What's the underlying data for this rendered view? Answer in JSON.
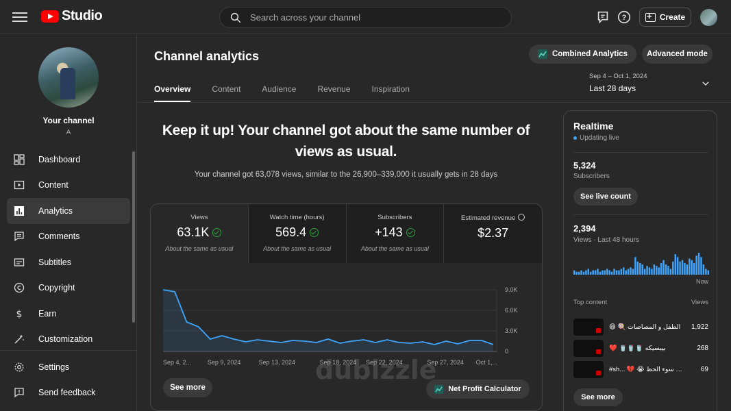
{
  "topbar": {
    "app_name": "Studio",
    "search_placeholder": "Search across your channel",
    "create_label": "Create"
  },
  "sidebar": {
    "channel_name": "Your channel",
    "channel_handle": "A",
    "items": [
      {
        "label": "Dashboard",
        "icon": "dashboard-icon"
      },
      {
        "label": "Content",
        "icon": "content-icon"
      },
      {
        "label": "Analytics",
        "icon": "analytics-icon",
        "active": true
      },
      {
        "label": "Comments",
        "icon": "comments-icon"
      },
      {
        "label": "Subtitles",
        "icon": "subtitles-icon"
      },
      {
        "label": "Copyright",
        "icon": "copyright-icon"
      },
      {
        "label": "Earn",
        "icon": "earn-icon"
      },
      {
        "label": "Customization",
        "icon": "customization-icon"
      }
    ],
    "bottom_items": [
      {
        "label": "Settings",
        "icon": "gear-icon"
      },
      {
        "label": "Send feedback",
        "icon": "feedback-icon"
      }
    ]
  },
  "main": {
    "title": "Channel analytics",
    "combined_label": "Combined Analytics",
    "advanced_label": "Advanced mode",
    "tabs": [
      {
        "label": "Overview",
        "active": true
      },
      {
        "label": "Content"
      },
      {
        "label": "Audience"
      },
      {
        "label": "Revenue"
      },
      {
        "label": "Inspiration"
      }
    ],
    "date_range": {
      "dates": "Sep 4 – Oct 1, 2024",
      "period": "Last 28 days"
    },
    "headline": "Keep it up! Your channel got about the same number of views as usual.",
    "subline": "Your channel got 63,078 views, similar to the 26,900–339,000 it usually gets in 28 days",
    "metrics": [
      {
        "name": "Views",
        "value": "63.1K",
        "note": "About the same as usual",
        "check": true
      },
      {
        "name": "Watch time (hours)",
        "value": "569.4",
        "note": "About the same as usual",
        "check": true
      },
      {
        "name": "Subscribers",
        "value": "+143",
        "note": "About the same as usual",
        "check": true
      },
      {
        "name": "Estimated revenue",
        "value": "$2.37",
        "note": "",
        "check": false
      }
    ],
    "see_more_label": "See more",
    "npc_label": "Net Profit Calculator",
    "watermark_text": "dubizzle"
  },
  "chart_data": {
    "type": "area",
    "x": [
      "Sep 4, 2...",
      "Sep 9, 2024",
      "Sep 13, 2024",
      "Sep 18, 2024",
      "Sep 22, 2024",
      "Sep 27, 2024",
      "Oct 1,..."
    ],
    "y_ticks": [
      "9.0K",
      "6.0K",
      "3.0K",
      "0"
    ],
    "ylim": [
      0,
      9000
    ],
    "series": [
      {
        "values": [
          9000,
          8700,
          4300,
          3600,
          1800,
          2300,
          1800,
          1400,
          1700,
          1500,
          1300,
          1600,
          1500,
          1300,
          1800,
          1200,
          1500,
          1700,
          1300,
          1700,
          1300,
          1200,
          1400,
          1000,
          1500,
          1100,
          1600,
          1600,
          1000
        ]
      }
    ],
    "color": "#3ea6ff"
  },
  "realtime": {
    "title": "Realtime",
    "live_label": "Updating live",
    "subscribers_value": "5,324",
    "subscribers_label": "Subscribers",
    "live_count_label": "See live count",
    "views_value": "2,394",
    "views_label": "Views · Last 48 hours",
    "now_label": "Now",
    "top_content_label": "Top content",
    "views_col_label": "Views",
    "see_more_label": "See more",
    "top_content": [
      {
        "title": "😄 🍭 الطفل و المصاصات",
        "views": "1,922"
      },
      {
        "title": "❤️ 🥤🥤🥤 بيبسيكه",
        "views": "268"
      },
      {
        "title": "#sh... 💔 😭 أوووه من سوء الحظ",
        "views": "69"
      }
    ],
    "hourly_bars": [
      3,
      2,
      2,
      3,
      2,
      3,
      4,
      2,
      3,
      3,
      4,
      2,
      3,
      3,
      4,
      3,
      2,
      4,
      3,
      3,
      4,
      5,
      3,
      4,
      5,
      4,
      12,
      9,
      8,
      7,
      4,
      6,
      5,
      4,
      7,
      6,
      5,
      8,
      10,
      7,
      6,
      4,
      9,
      14,
      12,
      9,
      10,
      8,
      7,
      11,
      10,
      8,
      13,
      15,
      12,
      7,
      4,
      3
    ]
  }
}
